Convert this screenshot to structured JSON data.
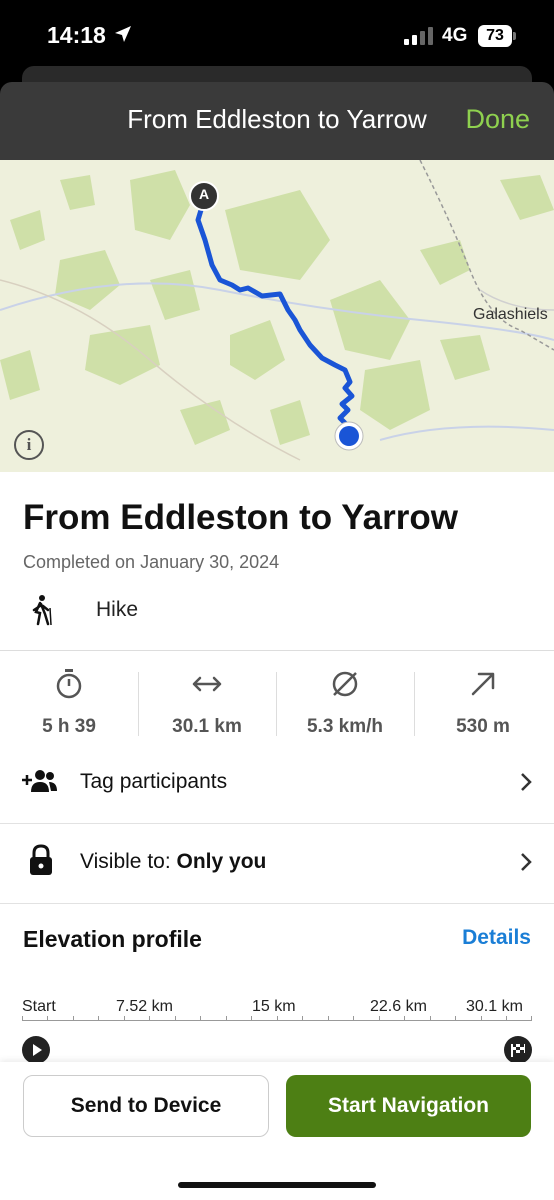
{
  "status_bar": {
    "time": "14:18",
    "network": "4G",
    "battery": "73"
  },
  "header": {
    "title": "From Eddleston to Yarrow",
    "done_label": "Done",
    "done_color": "#8fd14f"
  },
  "map": {
    "place_label": "Galashiels",
    "start_marker": "A",
    "route_color": "#1a55d6",
    "info_label": "i"
  },
  "activity": {
    "title": "From Eddleston to Yarrow",
    "completed": "Completed on January 30, 2024",
    "type_label": "Hike",
    "type_icon": "hiker-icon"
  },
  "stats": [
    {
      "icon": "stopwatch-icon",
      "value": "5 h 39"
    },
    {
      "icon": "distance-icon",
      "value": "30.1 km"
    },
    {
      "icon": "average-speed-icon",
      "value": "5.3 km/h"
    },
    {
      "icon": "elevation-gain-icon",
      "value": "530 m"
    }
  ],
  "rows": {
    "tag_label": "Tag participants",
    "visible_prefix": "Visible to: ",
    "visible_value": "Only you"
  },
  "elevation": {
    "title": "Elevation profile",
    "details_label": "Details",
    "details_color": "#1a7ed6",
    "axis_labels": [
      "Start",
      "7.52 km",
      "15 km",
      "22.6 km",
      "30.1 km"
    ]
  },
  "buttons": {
    "send_label": "Send to Device",
    "start_label": "Start Navigation",
    "start_color": "#4d7f14"
  }
}
